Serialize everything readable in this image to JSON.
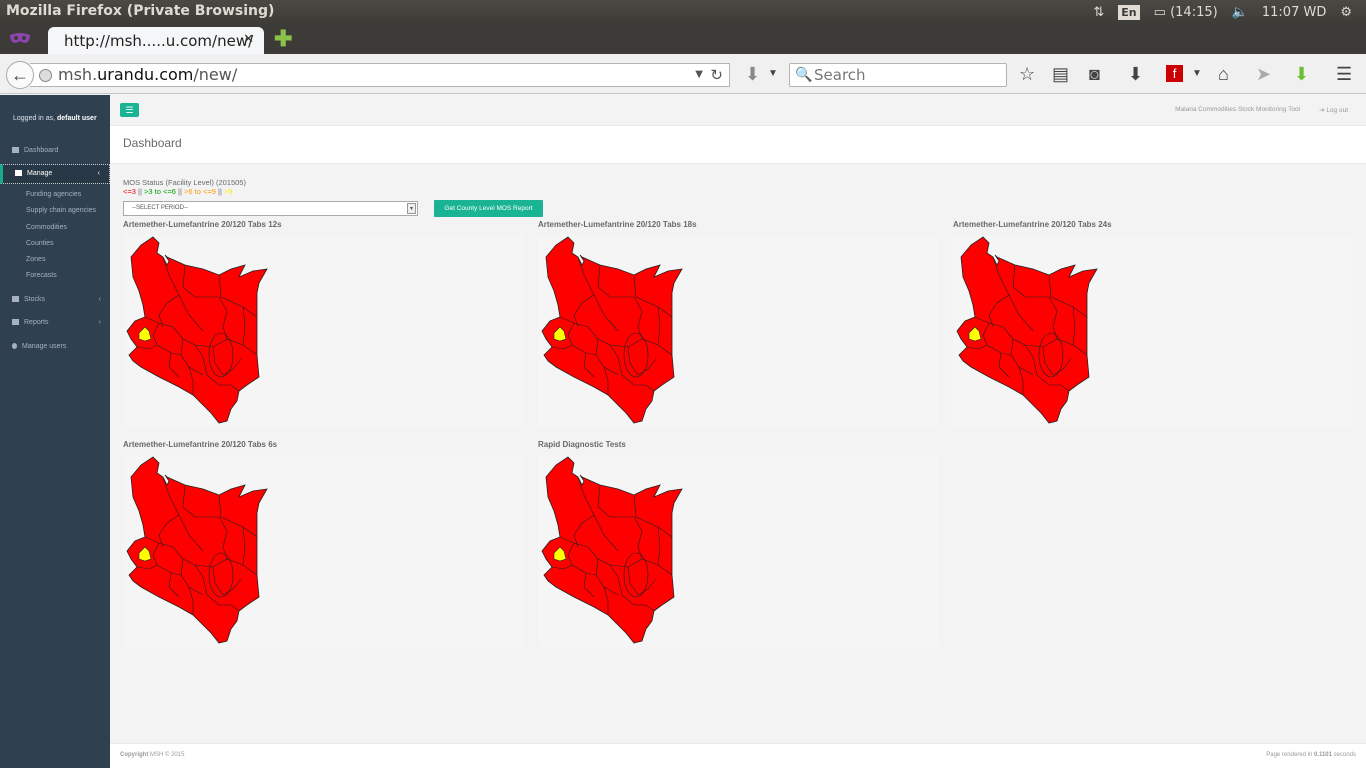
{
  "os": {
    "window_title": "Mozilla Firefox (Private Browsing)",
    "lang": "En",
    "battery": "(14:15)",
    "clock": "11:07 WD"
  },
  "browser": {
    "tab_title": "http://msh.....u.com/new/",
    "url_prefix": "msh.",
    "url_domain": "urandu.com",
    "url_path": "/new/",
    "search_placeholder": "Search"
  },
  "sidebar": {
    "logged_in_prefix": "Logged in as,",
    "user": "default user",
    "items": [
      {
        "label": "Dashboard",
        "icon": "grid-icon"
      },
      {
        "label": "Manage",
        "icon": "edit-icon",
        "active": true,
        "children": [
          "Funding agencies",
          "Supply chain agencies",
          "Commodities",
          "Counties",
          "Zones",
          "Forecasts"
        ]
      },
      {
        "label": "Stocks",
        "icon": "edit-icon"
      },
      {
        "label": "Reports",
        "icon": "bar-chart-icon"
      },
      {
        "label": "Manage users",
        "icon": "user-icon"
      }
    ]
  },
  "topnav": {
    "app_title": "Malaria Commodities Stock Monitoring Tool",
    "logout": "Log out"
  },
  "page": {
    "heading": "Dashboard",
    "mos_title": "MOS Status (Facility Level) (201505)",
    "legend": {
      "l1": "<=3",
      "sep1": " || ",
      "l2": ">3 to <=6",
      "sep2": " || ",
      "l3": ">6 to <=9",
      "sep3": " || ",
      "l4": ">9"
    },
    "period_select": "--SELECT PERIOD--",
    "report_button": "Get County Level MOS Report",
    "maps": [
      {
        "title": "Artemether-Lumefantrine 20/120 Tabs 12s"
      },
      {
        "title": "Artemether-Lumefantrine 20/120 Tabs 18s"
      },
      {
        "title": "Artemether-Lumefantrine 20/120 Tabs 24s"
      },
      {
        "title": "Artemether-Lumefantrine 20/120 Tabs 6s"
      },
      {
        "title": "Rapid Diagnostic Tests"
      }
    ],
    "map_colors": {
      "base": "#ff0000",
      "highlight": "#ffff00"
    }
  },
  "footer": {
    "copyright_bold": "Copyright",
    "copyright_rest": " MSH © 2015",
    "rendered_prefix": "Page rendered in ",
    "rendered_time": "0.1101",
    "rendered_suffix": " seconds"
  }
}
